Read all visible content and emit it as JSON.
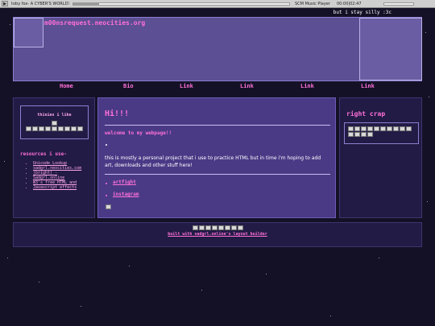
{
  "player": {
    "track": "toby fox- A CYBER'S WORLD?",
    "seek_fraction": 0.12,
    "app_name": "SCM Music Player",
    "time": "00:00|02:47"
  },
  "top_note": "but i stay silly :3c",
  "header": {
    "site_name": "m00nsrequest.neocities.org"
  },
  "nav": {
    "items": [
      "Home",
      "Bio",
      "Link",
      "Link",
      "Link",
      "Link"
    ]
  },
  "left": {
    "likes_title": "thinies i like",
    "resources_title": "resources i use-",
    "resources": [
      "Unicode Lookup",
      "sadgrl.neocities.com",
      "(bright) - ",
      "Sadgrl.online",
      "W3's free HTML and",
      "Javascript effects"
    ]
  },
  "main": {
    "heading": "Hi!!!",
    "welcome": "welcome to my webpage!!",
    "paragraph": "this is mostly a personal project that i use to practice HTML but in time i'm hoping to add art, downloads and other stuff here!",
    "links": [
      "artfight",
      "instagram"
    ]
  },
  "right": {
    "title": "right crap"
  },
  "footer": {
    "credit": "built with sadgrl.online's layout builder"
  }
}
